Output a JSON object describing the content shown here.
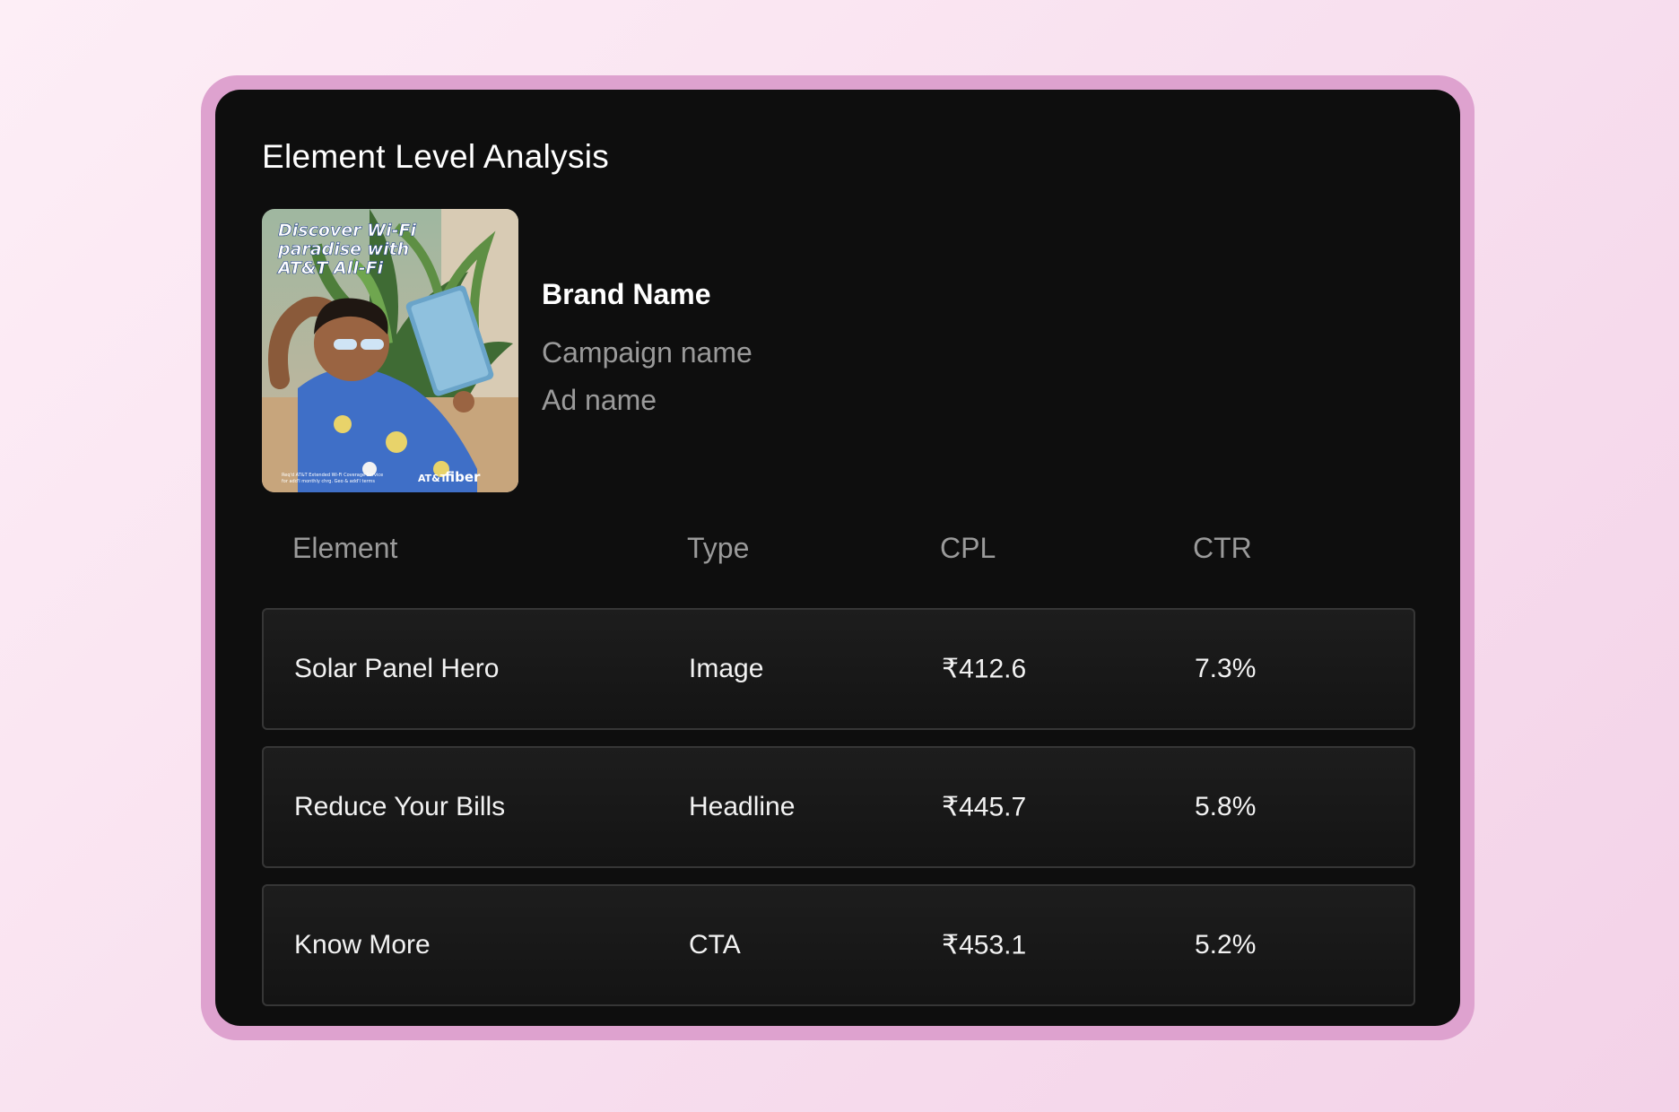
{
  "header": {
    "title": "Element Level Analysis"
  },
  "ad": {
    "headline_line1": "Discover Wi-Fi",
    "headline_line2": "paradise with",
    "headline_line3": "AT&T All-Fi",
    "logo_prefix": "AT&T",
    "logo_word": "fiber",
    "disclaimer_line1": "Req'd AT&T Extended Wi-Fi Coverage Service",
    "disclaimer_line2": "for add'l monthly chrg. Geo & add'l terms"
  },
  "meta": {
    "brand_name": "Brand Name",
    "campaign_name": "Campaign name",
    "ad_name": "Ad name"
  },
  "table": {
    "columns": [
      "Element",
      "Type",
      "CPL",
      "CTR"
    ],
    "rows": [
      {
        "element": "Solar Panel Hero",
        "type": "Image",
        "cpl": "₹412.6",
        "ctr": "7.3%"
      },
      {
        "element": "Reduce Your Bills",
        "type": "Headline",
        "cpl": "₹445.7",
        "ctr": "5.8%"
      },
      {
        "element": "Know More",
        "type": "CTA",
        "cpl": "₹453.1",
        "ctr": "5.2%"
      }
    ]
  },
  "colors": {
    "page_bg": "#f8e0ef",
    "frame": "#dea2cf",
    "card_bg": "#0e0e0e",
    "row_border": "#363636"
  }
}
